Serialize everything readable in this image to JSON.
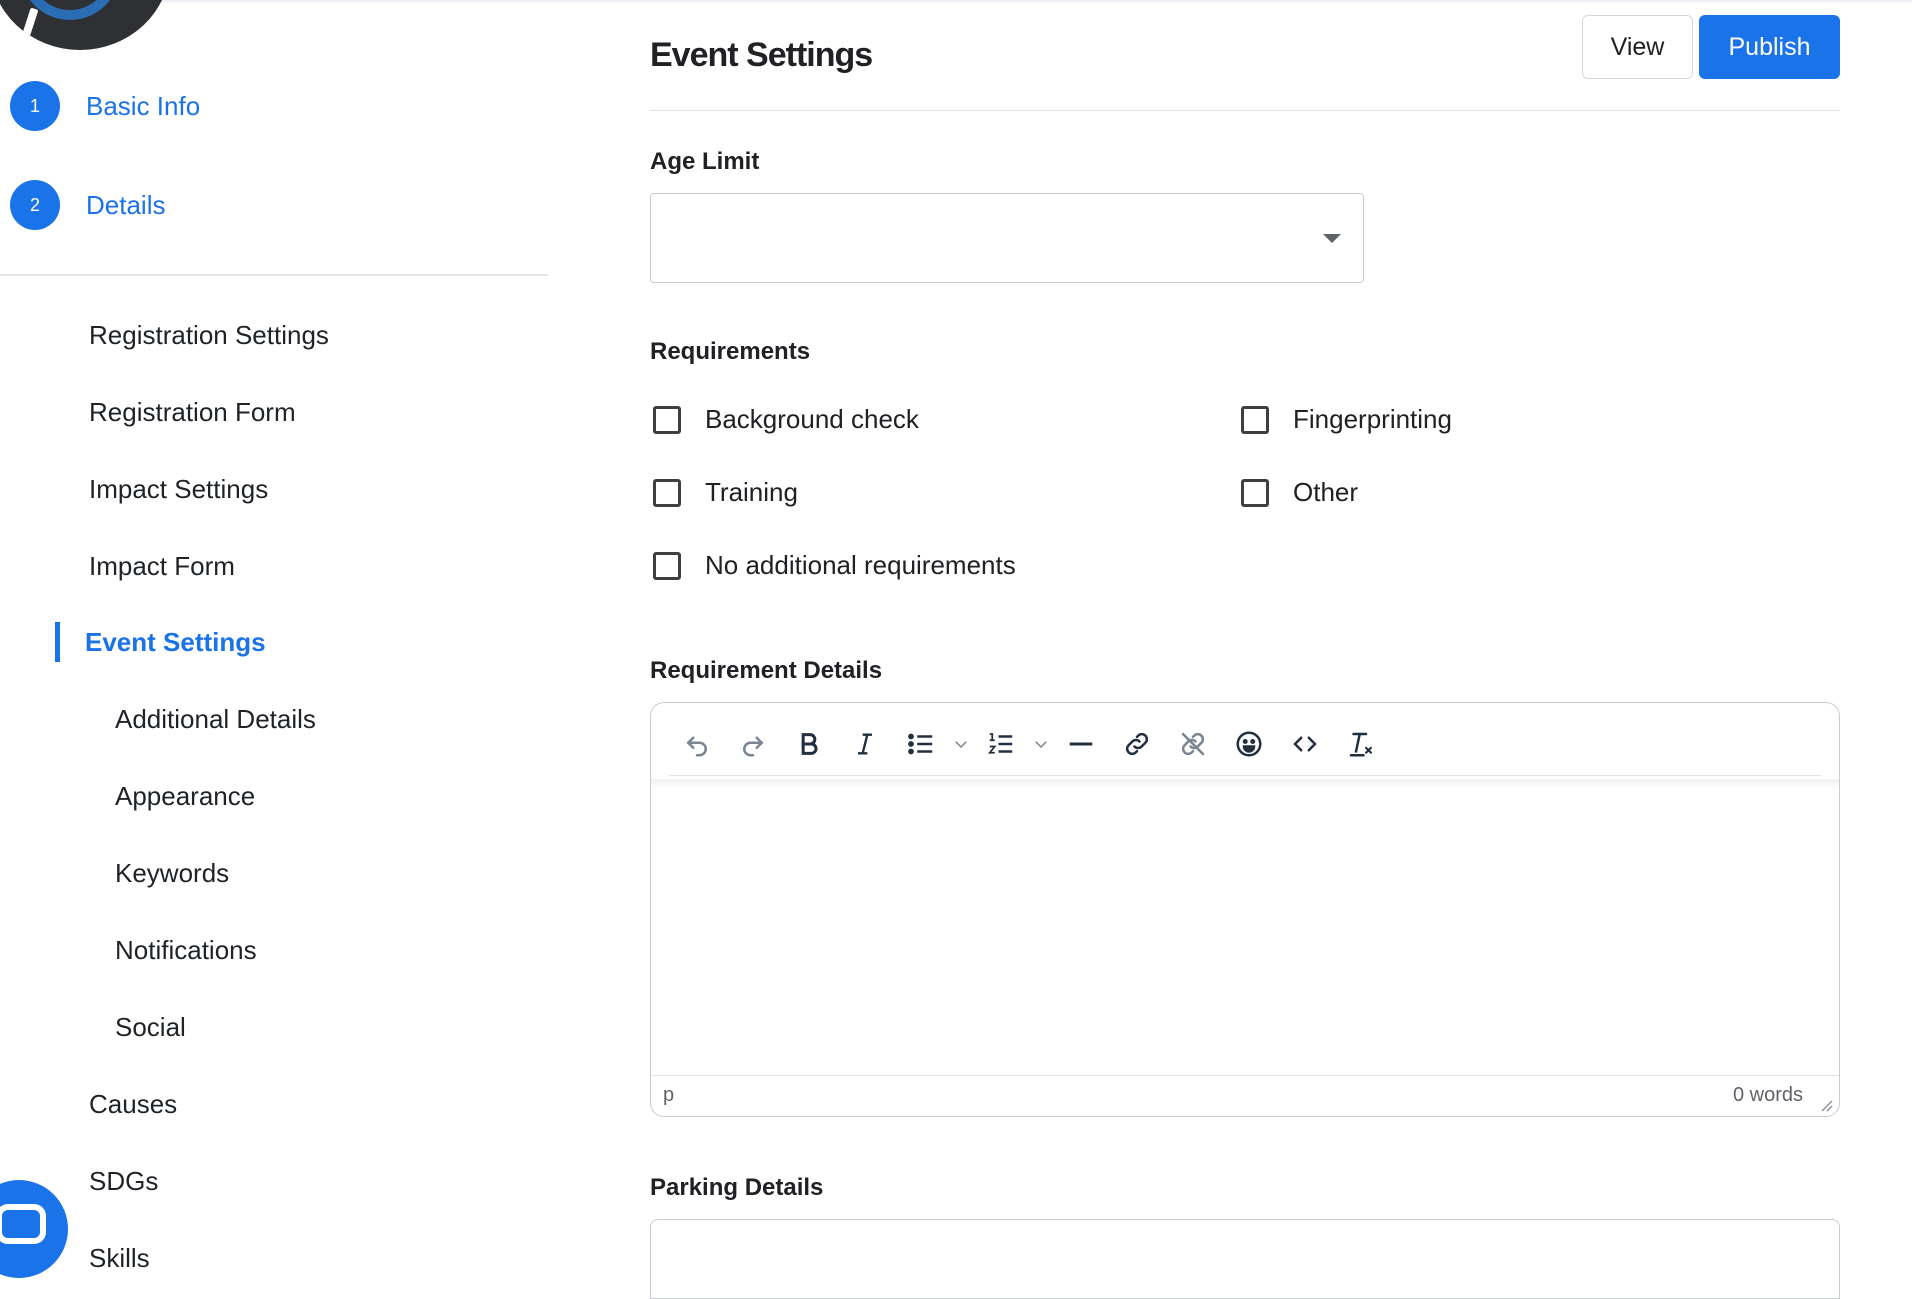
{
  "sidebar": {
    "steps": [
      {
        "number": "1",
        "label": "Basic Info"
      },
      {
        "number": "2",
        "label": "Details"
      }
    ],
    "nav": [
      {
        "label": "Registration Settings"
      },
      {
        "label": "Registration Form"
      },
      {
        "label": "Impact Settings"
      },
      {
        "label": "Impact Form"
      },
      {
        "label": "Event Settings",
        "active": true
      },
      {
        "label": "Additional Details"
      },
      {
        "label": "Appearance"
      },
      {
        "label": "Keywords"
      },
      {
        "label": "Notifications"
      },
      {
        "label": "Social"
      },
      {
        "label": "Causes"
      },
      {
        "label": "SDGs"
      },
      {
        "label": "Skills"
      }
    ]
  },
  "header": {
    "title": "Event Settings",
    "view_label": "View",
    "publish_label": "Publish"
  },
  "form": {
    "age_limit": {
      "label": "Age Limit",
      "value": ""
    },
    "requirements": {
      "label": "Requirements",
      "options": [
        {
          "label": "Background check",
          "checked": false
        },
        {
          "label": "Fingerprinting",
          "checked": false
        },
        {
          "label": "Training",
          "checked": false
        },
        {
          "label": "Other",
          "checked": false
        },
        {
          "label": "No additional requirements",
          "checked": false
        }
      ]
    },
    "requirement_details": {
      "label": "Requirement Details",
      "toolbar": [
        "undo-icon",
        "redo-icon",
        "bold-icon",
        "italic-icon",
        "bullet-list-icon",
        "chevron-down-icon",
        "numbered-list-icon",
        "chevron-down-icon",
        "horizontal-rule-icon",
        "link-icon",
        "unlink-icon",
        "emoji-icon",
        "source-code-icon",
        "clear-formatting-icon"
      ],
      "status_path": "p",
      "word_count": "0 words"
    },
    "parking_details": {
      "label": "Parking Details",
      "value": ""
    }
  },
  "colors": {
    "accent": "#1a73e8",
    "text": "#202124",
    "border": "#c9ccd0"
  }
}
